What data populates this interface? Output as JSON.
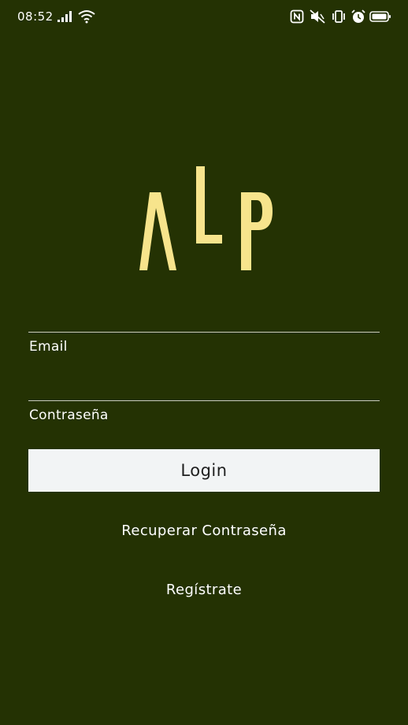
{
  "status_bar": {
    "time": "08:52",
    "icons": [
      "signal-icon",
      "wifi-icon",
      "nfc-icon",
      "mute-icon",
      "vibrate-icon",
      "alarm-icon",
      "battery-icon"
    ]
  },
  "logo": {
    "text": "ALP",
    "color": "#f7e48c"
  },
  "form": {
    "email_label": "Email",
    "email_value": "",
    "password_label": "Contraseña",
    "password_value": "",
    "login_label": "Login"
  },
  "links": {
    "recover_label": "Recuperar Contraseña",
    "register_label": "Regístrate"
  },
  "colors": {
    "background": "#243203",
    "button": "#f2f4f5",
    "logo": "#f7e48c"
  }
}
